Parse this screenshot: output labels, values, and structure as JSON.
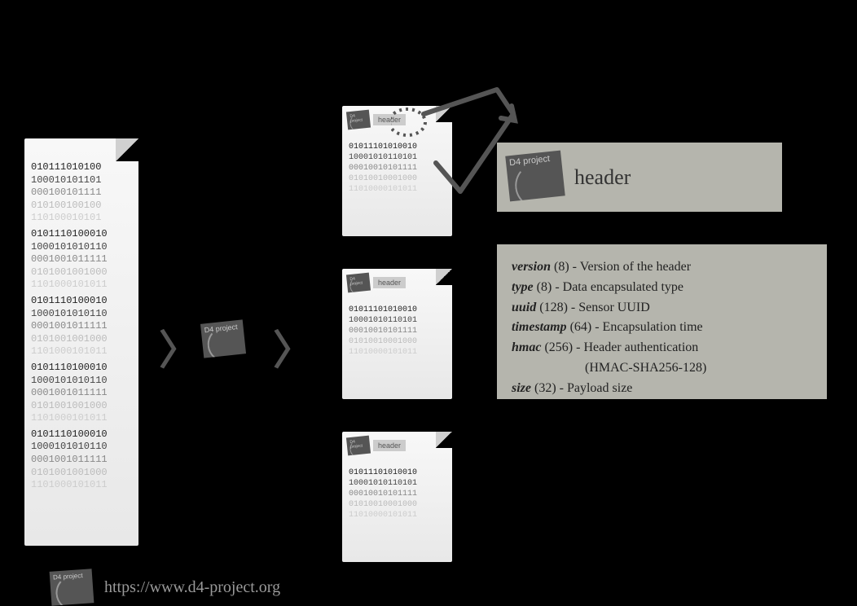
{
  "d4_label": "D4 project",
  "mini_header_label": "header",
  "header_box": {
    "title": "header"
  },
  "fields": {
    "f1_name": "version",
    "f1_bits": "(8)",
    "f1_desc": "- Version of the header",
    "f2_name": "type",
    "f2_bits": "(8)",
    "f2_desc": "- Data encapsulated type",
    "f3_name": "uuid",
    "f3_bits": "(128)",
    "f3_desc": "- Sensor UUID",
    "f4_name": "timestamp",
    "f4_bits": "(64)",
    "f4_desc": "- Encapsulation time",
    "f5_name": "hmac",
    "f5_bits": "(256)",
    "f5_desc": "- Header authentication",
    "f5_sub": "(HMAC-SHA256-128)",
    "f6_name": "size",
    "f6_bits": "(32)",
    "f6_desc": "- Payload size"
  },
  "binary": {
    "r1": "010111010100",
    "r2": "100010101101",
    "r3": "000100101111",
    "r4": "010100100100",
    "r5": "110100010101",
    "s1": "0101110100010",
    "s2": "1000101010110",
    "s3": "0001001011111",
    "s4": "0101001001000",
    "s5": "1101000101011"
  },
  "binary_small": {
    "r1": "01011101010010",
    "r2": "10001010110101",
    "r3": "00010010101111",
    "r4": "01010010001000",
    "r5": "11010000101011"
  },
  "footer": {
    "url": "https://www.d4-project.org"
  }
}
